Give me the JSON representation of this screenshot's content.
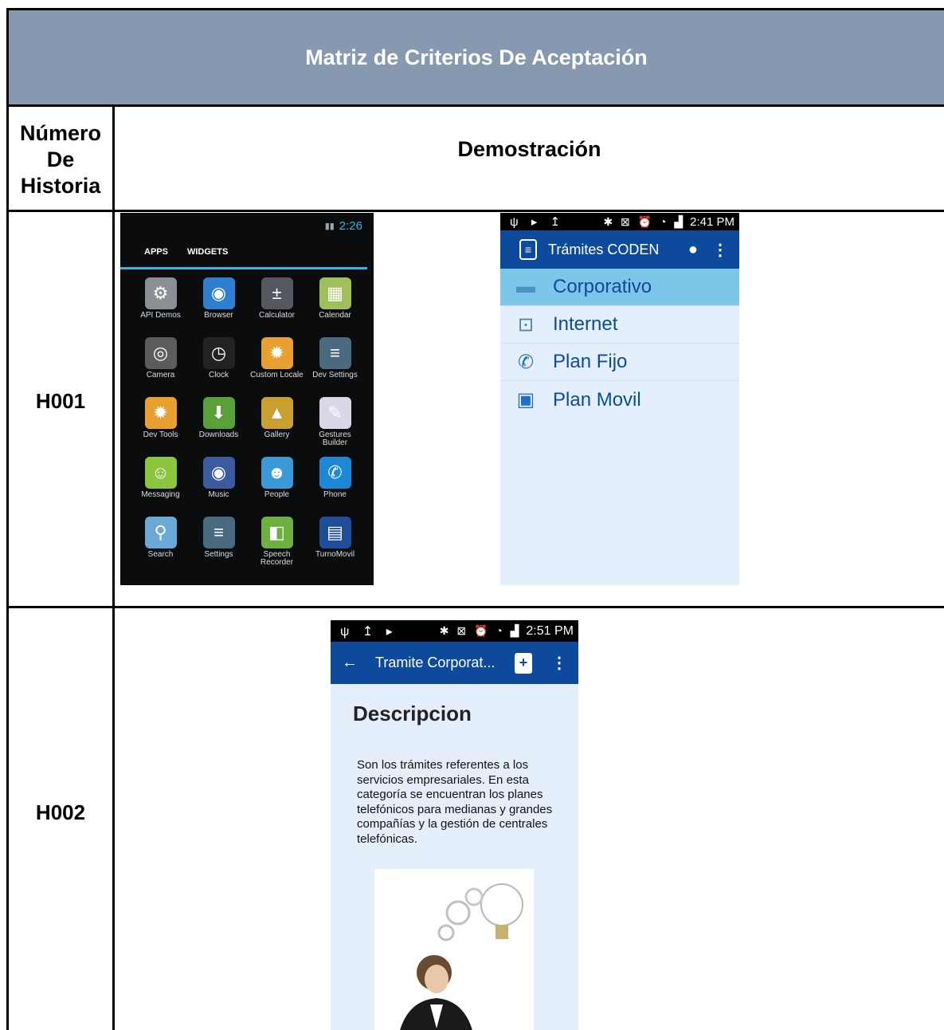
{
  "table": {
    "title": "Matriz de Criterios De Aceptación",
    "col_number": "Número De Historia",
    "col_demo": "Demostración",
    "rows": [
      {
        "id": "H001"
      },
      {
        "id": "H002"
      }
    ]
  },
  "phone_drawer": {
    "time": "2:26",
    "tabs": [
      "APPS",
      "WIDGETS"
    ],
    "apps": [
      {
        "label": "API Demos",
        "icon": "folder-gear-icon",
        "color": "#8a8f96"
      },
      {
        "label": "Browser",
        "icon": "globe-icon",
        "color": "#2f7fd0"
      },
      {
        "label": "Calculator",
        "icon": "calculator-icon",
        "color": "#55595f"
      },
      {
        "label": "Calendar",
        "icon": "calendar-icon",
        "color": "#9fbf5a"
      },
      {
        "label": "Camera",
        "icon": "camera-icon",
        "color": "#5c5c5c"
      },
      {
        "label": "Clock",
        "icon": "clock-icon",
        "color": "#222222"
      },
      {
        "label": "Custom Locale",
        "icon": "gear-icon",
        "color": "#e8a030"
      },
      {
        "label": "Dev Settings",
        "icon": "settings-icon",
        "color": "#4a6a80"
      },
      {
        "label": "Dev Tools",
        "icon": "gear-icon",
        "color": "#e8a030"
      },
      {
        "label": "Downloads",
        "icon": "download-icon",
        "color": "#5aa03a"
      },
      {
        "label": "Gallery",
        "icon": "gallery-icon",
        "color": "#c9a030"
      },
      {
        "label": "Gestures Builder",
        "icon": "gestures-icon",
        "color": "#d8d8e8"
      },
      {
        "label": "Messaging",
        "icon": "messaging-icon",
        "color": "#8cc63f"
      },
      {
        "label": "Music",
        "icon": "music-icon",
        "color": "#3c5aa0"
      },
      {
        "label": "People",
        "icon": "people-icon",
        "color": "#3a9ad8"
      },
      {
        "label": "Phone",
        "icon": "phone-icon",
        "color": "#1e88d8"
      },
      {
        "label": "Search",
        "icon": "search-icon",
        "color": "#6aa8d8"
      },
      {
        "label": "Settings",
        "icon": "settings-icon",
        "color": "#4a6a80"
      },
      {
        "label": "Speech Recorder",
        "icon": "speech-recorder-icon",
        "color": "#6cb040"
      },
      {
        "label": "TurnoMovil",
        "icon": "turnomovil-icon",
        "color": "#1e4e9a"
      }
    ]
  },
  "phone_tramites": {
    "time": "2:41 PM",
    "title": "Trámites CODEN",
    "items": [
      {
        "label": "Corporativo",
        "icon": "briefcase-icon",
        "selected": true
      },
      {
        "label": "Internet",
        "icon": "network-icon",
        "selected": false
      },
      {
        "label": "Plan Fijo",
        "icon": "phone-icon",
        "selected": false
      },
      {
        "label": "Plan Movil",
        "icon": "mobile-icon",
        "selected": false
      }
    ]
  },
  "phone_corporativo": {
    "time": "2:51 PM",
    "title": "Tramite Corporat...",
    "heading": "Descripcion",
    "body": "Son los trámites referentes a los servicios empresariales. En esta categoría se encuentran los planes telefónicos para medianas y grandes compañías y la gestión de centrales telefónicas."
  }
}
